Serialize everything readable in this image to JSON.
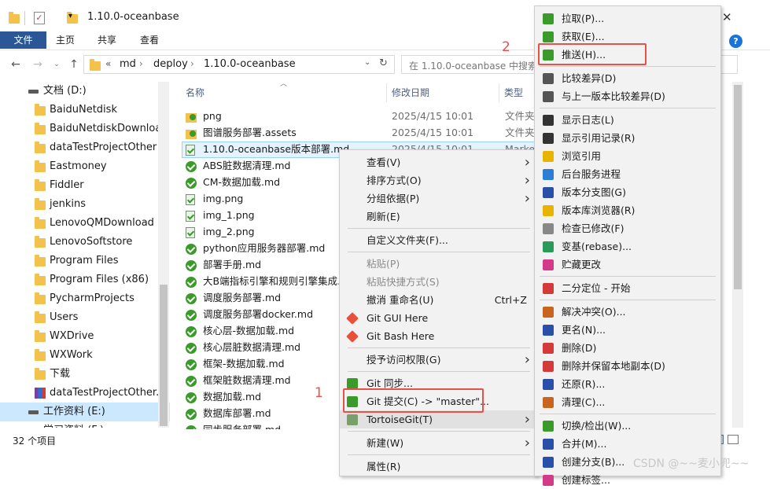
{
  "window": {
    "title": "1.10.0-oceanbase",
    "close_glyph": "✕",
    "help_glyph": "?"
  },
  "ribbon": {
    "file_tab": "文件",
    "tabs": [
      "主页",
      "共享",
      "查看"
    ]
  },
  "address": {
    "breadcrumb": [
      "md",
      "deploy",
      "1.10.0-oceanbase"
    ],
    "overflow": "«",
    "search_placeholder": "在 1.10.0-oceanbase 中搜索"
  },
  "nav_pane": {
    "items": [
      {
        "label": "文档 (D:)",
        "kind": "drive"
      },
      {
        "label": "BaiduNetdisk",
        "kind": "folder"
      },
      {
        "label": "BaiduNetdiskDownload",
        "kind": "folder"
      },
      {
        "label": "dataTestProjectOther",
        "kind": "folder"
      },
      {
        "label": "Eastmoney",
        "kind": "folder"
      },
      {
        "label": "Fiddler",
        "kind": "folder"
      },
      {
        "label": "jenkins",
        "kind": "folder"
      },
      {
        "label": "LenovoQMDownload",
        "kind": "folder"
      },
      {
        "label": "LenovoSoftstore",
        "kind": "folder"
      },
      {
        "label": "Program Files",
        "kind": "folder"
      },
      {
        "label": "Program Files (x86)",
        "kind": "folder"
      },
      {
        "label": "PycharmProjects",
        "kind": "folder"
      },
      {
        "label": "Users",
        "kind": "folder"
      },
      {
        "label": "WXDrive",
        "kind": "folder"
      },
      {
        "label": "WXWork",
        "kind": "folder"
      },
      {
        "label": "下载",
        "kind": "folder"
      },
      {
        "label": "dataTestProjectOther.zi",
        "kind": "zip"
      },
      {
        "label": "工作资料 (E:)",
        "kind": "drive"
      },
      {
        "label": "学习资料 (F:)",
        "kind": "drive"
      }
    ]
  },
  "columns": {
    "name": "名称",
    "date": "修改日期",
    "type": "类型"
  },
  "files": [
    {
      "name": "png",
      "date": "2025/4/15 10:01",
      "type": "文件夹",
      "icon": "folder-check"
    },
    {
      "name": "图谱服务部署.assets",
      "date": "2025/4/15 10:01",
      "type": "文件夹",
      "icon": "folder-check"
    },
    {
      "name": "1.10.0-oceanbase版本部署.md",
      "date": "2025/4/15 10:01",
      "type": "Marke",
      "icon": "doc-check"
    },
    {
      "name": "ABS脏数据清理.md",
      "date": "",
      "type": "",
      "icon": "check"
    },
    {
      "name": "CM-数据加载.md",
      "date": "",
      "type": "",
      "icon": "check"
    },
    {
      "name": "img.png",
      "date": "",
      "type": "",
      "icon": "img-check"
    },
    {
      "name": "img_1.png",
      "date": "",
      "type": "",
      "icon": "img-check"
    },
    {
      "name": "img_2.png",
      "date": "",
      "type": "",
      "icon": "img-check"
    },
    {
      "name": "python应用服务器部署.md",
      "date": "",
      "type": "",
      "icon": "check"
    },
    {
      "name": "部署手册.md",
      "date": "",
      "type": "",
      "icon": "check"
    },
    {
      "name": "大B端指标引擎和规则引擎集成.m",
      "date": "",
      "type": "",
      "icon": "check"
    },
    {
      "name": "调度服务部署.md",
      "date": "",
      "type": "",
      "icon": "check"
    },
    {
      "name": "调度服务部署docker.md",
      "date": "",
      "type": "",
      "icon": "check"
    },
    {
      "name": "核心层-数据加载.md",
      "date": "",
      "type": "",
      "icon": "check"
    },
    {
      "name": "核心层脏数据清理.md",
      "date": "",
      "type": "",
      "icon": "check"
    },
    {
      "name": "框架-数据加载.md",
      "date": "",
      "type": "",
      "icon": "check"
    },
    {
      "name": "框架脏数据清理.md",
      "date": "",
      "type": "",
      "icon": "check"
    },
    {
      "name": "数据加载.md",
      "date": "",
      "type": "",
      "icon": "check"
    },
    {
      "name": "数据库部署.md",
      "date": "",
      "type": "",
      "icon": "check"
    },
    {
      "name": "同步服务部署.md",
      "date": "",
      "type": "",
      "icon": "check"
    }
  ],
  "status": {
    "count": "32 个项目"
  },
  "context_menu": {
    "items": [
      {
        "label": "查看(V)",
        "submenu": true
      },
      {
        "label": "排序方式(O)",
        "submenu": true
      },
      {
        "label": "分组依据(P)",
        "submenu": true
      },
      {
        "label": "刷新(E)"
      },
      {
        "sep": true
      },
      {
        "label": "自定义文件夹(F)..."
      },
      {
        "sep": true
      },
      {
        "label": "粘贴(P)",
        "disabled": true
      },
      {
        "label": "粘贴快捷方式(S)",
        "disabled": true
      },
      {
        "label": "撤消 重命名(U)",
        "shortcut": "Ctrl+Z"
      },
      {
        "label": "Git GUI Here",
        "icon": "git-icon"
      },
      {
        "label": "Git Bash Here",
        "icon": "git-icon"
      },
      {
        "sep": true
      },
      {
        "label": "授予访问权限(G)",
        "submenu": true
      },
      {
        "sep": true
      },
      {
        "label": "Git 同步...",
        "icon": "git-sync-icon"
      },
      {
        "label": "Git 提交(C) -> \"master\"...",
        "icon": "git-commit-icon"
      },
      {
        "label": "TortoiseGit(T)",
        "icon": "tortoise-icon",
        "submenu": true
      },
      {
        "sep": true
      },
      {
        "label": "新建(W)",
        "submenu": true
      },
      {
        "sep": true
      },
      {
        "label": "属性(R)"
      }
    ]
  },
  "tortoise_menu": {
    "items": [
      {
        "label": "拉取(P)...",
        "icon": "pull-icon",
        "color": "#3a9a2a"
      },
      {
        "label": "获取(E)...",
        "icon": "fetch-icon",
        "color": "#3a9a2a"
      },
      {
        "label": "推送(H)...",
        "icon": "push-icon",
        "color": "#3a9a2a"
      },
      {
        "sep": true
      },
      {
        "label": "比较差异(D)",
        "icon": "diff-icon",
        "color": "#555555"
      },
      {
        "label": "与上一版本比较差异(D)",
        "icon": "diff-prev-icon",
        "color": "#555555"
      },
      {
        "sep": true
      },
      {
        "label": "显示日志(L)",
        "icon": "log-icon",
        "color": "#333333"
      },
      {
        "label": "显示引用记录(R)",
        "icon": "reflog-icon",
        "color": "#333333"
      },
      {
        "label": "浏览引用",
        "icon": "browse-ref-icon",
        "color": "#e8b400"
      },
      {
        "label": "后台服务进程",
        "icon": "daemon-icon",
        "color": "#2a7fd4"
      },
      {
        "label": "版本分支图(G)",
        "icon": "revgraph-icon",
        "color": "#2a4fa8"
      },
      {
        "label": "版本库浏览器(R)",
        "icon": "repo-browser-icon",
        "color": "#e8b400"
      },
      {
        "label": "检查已修改(F)",
        "icon": "check-modified-icon",
        "color": "#888888"
      },
      {
        "label": "变基(rebase)...",
        "icon": "rebase-icon",
        "color": "#2a9a5a"
      },
      {
        "label": "贮藏更改",
        "icon": "stash-icon",
        "color": "#d43a8a"
      },
      {
        "sep": true
      },
      {
        "label": "二分定位 - 开始",
        "icon": "bisect-icon",
        "color": "#d43a3a"
      },
      {
        "sep": true
      },
      {
        "label": "解决冲突(O)...",
        "icon": "resolve-icon",
        "color": "#c8641e"
      },
      {
        "label": "更名(N)...",
        "icon": "rename-icon",
        "color": "#2a4fa8"
      },
      {
        "label": "删除(D)",
        "icon": "delete-icon",
        "color": "#d43a3a"
      },
      {
        "label": "删除并保留本地副本(D)",
        "icon": "delete-keep-icon",
        "color": "#d43a3a"
      },
      {
        "label": "还原(R)...",
        "icon": "revert-icon",
        "color": "#2a4fa8"
      },
      {
        "label": "清理(C)...",
        "icon": "cleanup-icon",
        "color": "#c8641e"
      },
      {
        "sep": true
      },
      {
        "label": "切换/检出(W)...",
        "icon": "switch-icon",
        "color": "#3a9a2a"
      },
      {
        "label": "合并(M)...",
        "icon": "merge-icon",
        "color": "#2a4fa8"
      },
      {
        "label": "创建分支(B)...",
        "icon": "branch-icon",
        "color": "#2a4fa8"
      },
      {
        "label": "创建标签...",
        "icon": "tag-icon",
        "color": "#d43a8a"
      }
    ]
  },
  "annotations": {
    "one": "1",
    "two": "2"
  },
  "watermark": "CSDN @~~麦小兜~~"
}
